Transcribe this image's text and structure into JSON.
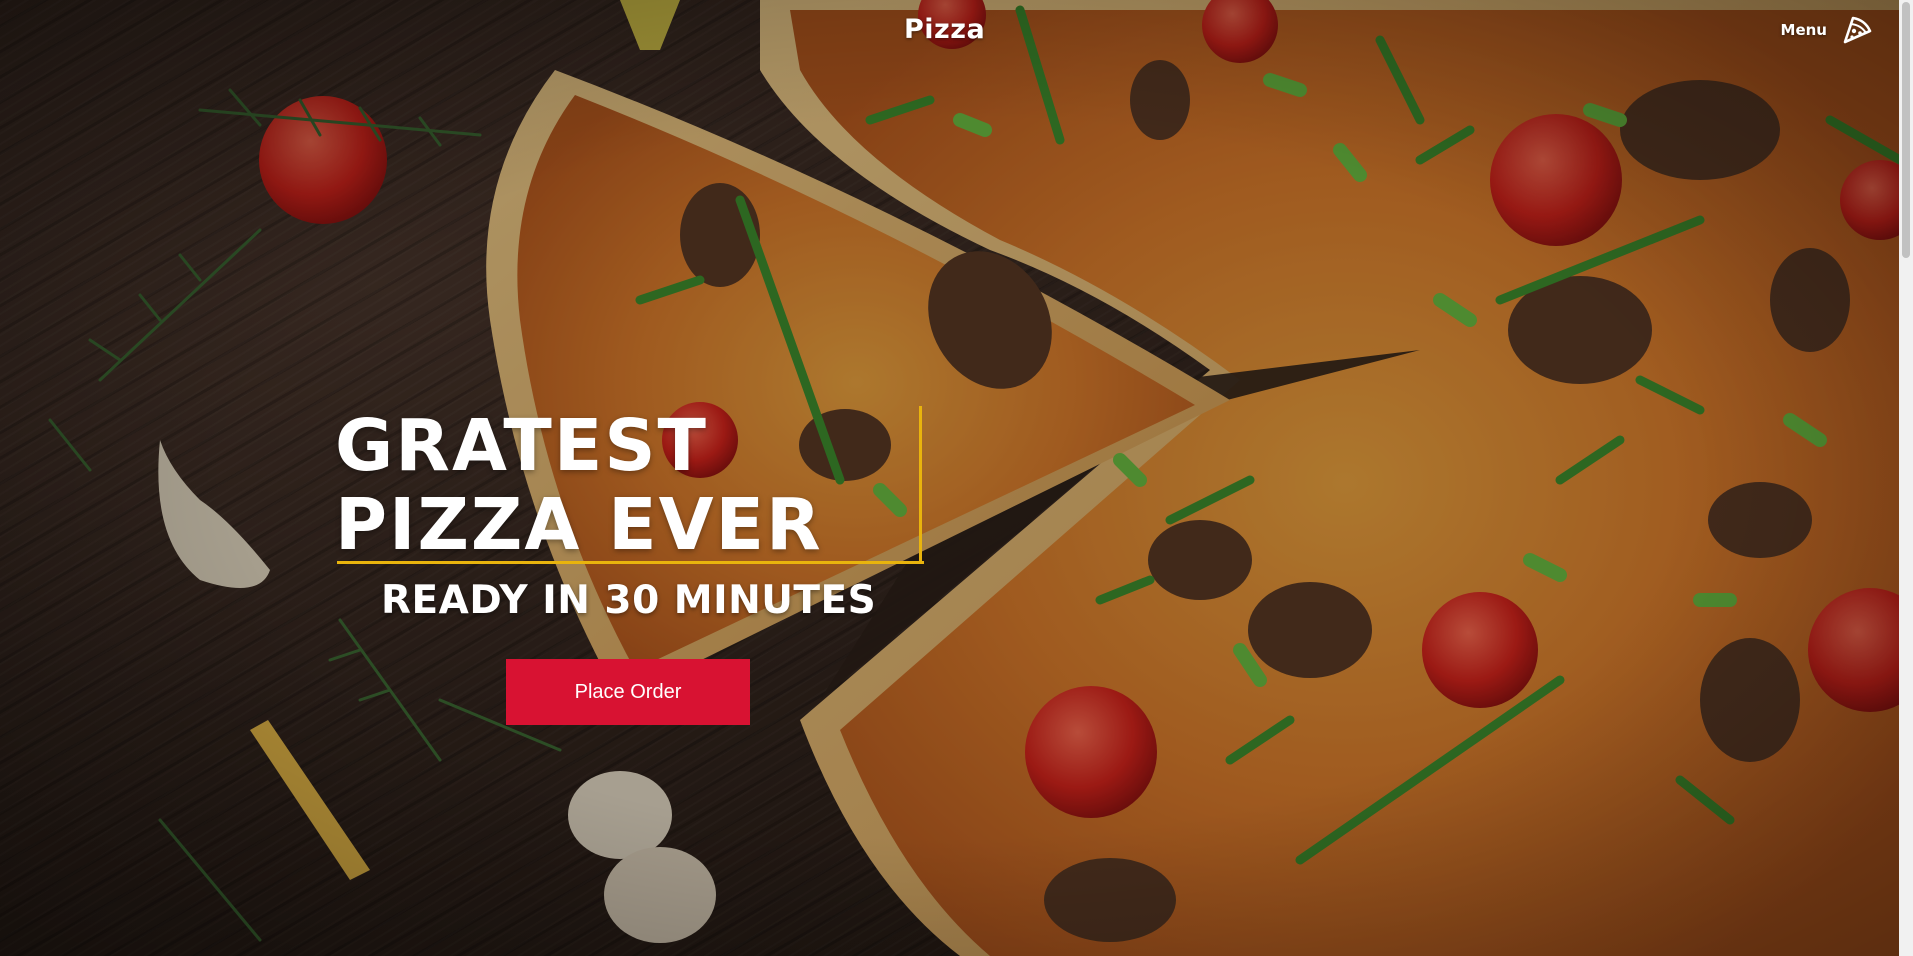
{
  "header": {
    "brand": "Pizza",
    "menu_label": "Menu",
    "menu_icon": "pizza-slice-icon"
  },
  "hero": {
    "headline_line1": "GRATEST",
    "headline_line2": "PIZZA EVER",
    "subheadline": "READY IN 30 MINUTES",
    "cta_label": "Place Order"
  },
  "colors": {
    "accent_yellow": "#e9b40d",
    "cta_red": "#d81232",
    "text": "#ffffff"
  },
  "scrollbar": {
    "scroll_fraction": 0
  }
}
